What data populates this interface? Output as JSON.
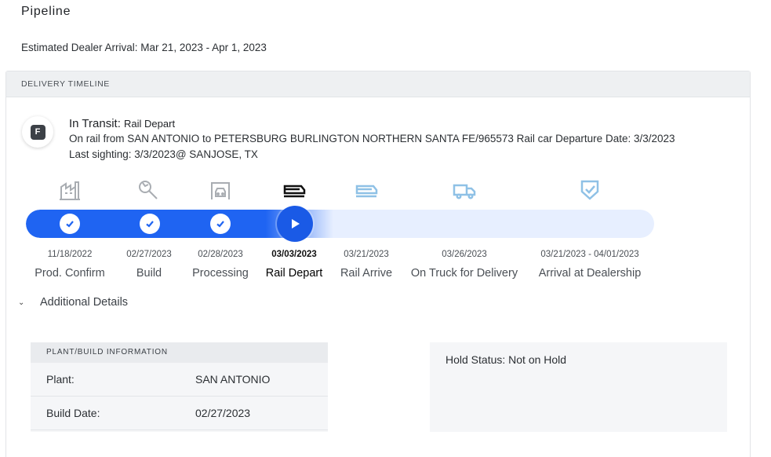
{
  "page": {
    "title": "Pipeline",
    "estimated_arrival": "Estimated Dealer Arrival: Mar 21, 2023 - Apr 1, 2023"
  },
  "timeline": {
    "header": "DELIVERY TIMELINE",
    "badge": "F",
    "status_label": "In Transit:",
    "status_value": "Rail Depart",
    "detail_line": "On rail from SAN ANTONIO to PETERSBURG BURLINGTON NORTHERN SANTA FE/965573 Rail car Departure Date: 3/3/2023",
    "sighting_line": "Last sighting: 3/3/2023@ SANJOSE, TX",
    "steps": [
      {
        "date": "11/18/2022",
        "label": "Prod. Confirm",
        "state": "done",
        "icon": "factory-icon"
      },
      {
        "date": "02/27/2023",
        "label": "Build",
        "state": "done",
        "icon": "wrench-icon"
      },
      {
        "date": "02/28/2023",
        "label": "Processing",
        "state": "done",
        "icon": "car-wash-icon"
      },
      {
        "date": "03/03/2023",
        "label": "Rail Depart",
        "state": "current",
        "icon": "rail-icon"
      },
      {
        "date": "03/21/2023",
        "label": "Rail Arrive",
        "state": "pending",
        "icon": "rail-icon"
      },
      {
        "date": "03/26/2023",
        "label": "On Truck for Delivery",
        "state": "pending",
        "icon": "truck-icon"
      },
      {
        "date": "03/21/2023 - 04/01/2023",
        "label": "Arrival at Dealership",
        "state": "pending",
        "icon": "shield-check-icon"
      }
    ],
    "progress_fraction": 0.44
  },
  "details": {
    "toggle_label": "Additional Details",
    "plant_header": "PLANT/BUILD INFORMATION",
    "plant_label": "Plant:",
    "plant_value": "SAN ANTONIO",
    "build_date_label": "Build Date:",
    "build_date_value": "02/27/2023",
    "hold_status": "Hold Status: Not on Hold"
  },
  "colors": {
    "accent": "#1f64f2",
    "track": "#e7efff",
    "done_icon": "#a9adb2",
    "pending_icon": "#8fc1e6"
  }
}
